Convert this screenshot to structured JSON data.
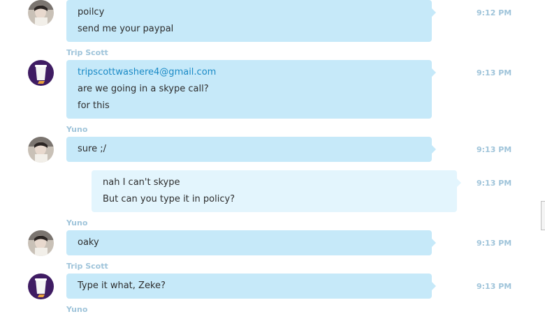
{
  "conversation": {
    "messages": [
      {
        "sender": "",
        "lines": [
          "poilcy",
          "send me your paypal"
        ],
        "time": "9:12 PM",
        "avatar": "yuno-avatar"
      },
      {
        "sender": "Trip Scott",
        "lines": [
          "tripscottwashere4@gmail.com",
          "are we going in a skype call?",
          "for this"
        ],
        "time": "9:13 PM",
        "avatar": "trip-avatar"
      },
      {
        "sender": "Yuno",
        "lines": [
          "sure ;/"
        ],
        "time": "9:13 PM",
        "avatar": "yuno-avatar"
      },
      {
        "sender": "",
        "lines": [
          "nah I can't skype",
          "But can you type it in policy?"
        ],
        "time": "9:13 PM",
        "avatar": ""
      },
      {
        "sender": "Yuno",
        "lines": [
          "oaky"
        ],
        "time": "9:13 PM",
        "avatar": "yuno-avatar"
      },
      {
        "sender": "Trip Scott",
        "lines": [
          "Type it what, Zeke?"
        ],
        "time": "9:13 PM",
        "avatar": "trip-avatar"
      },
      {
        "sender": "Yuno",
        "lines": [],
        "time": "",
        "avatar": ""
      }
    ]
  },
  "colors": {
    "incoming_bubble": "#c6e9f9",
    "outgoing_bubble": "#e3f5fd",
    "meta_text": "#9fc4da",
    "link": "#1a8ac6"
  }
}
